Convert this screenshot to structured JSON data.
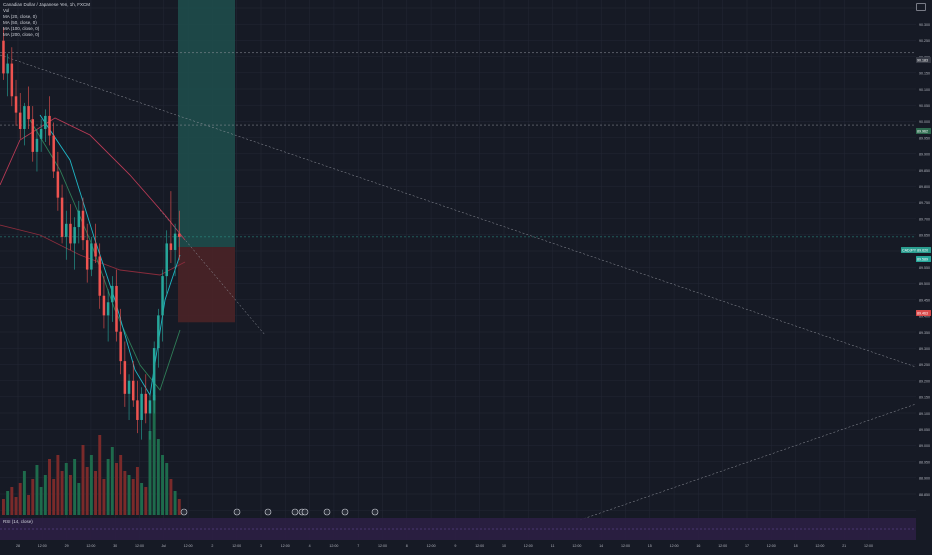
{
  "legend": {
    "symbol": "Canadian Dollar / Japanese Yen, 1h, FXCM",
    "vol": "Vol",
    "ma1": "MA (20, close, 0)",
    "ma2": "MA (50, close, 0)",
    "ma3": "MA (100, close, 0)",
    "ma4": "MA (200, close, 0)"
  },
  "rsi": {
    "label": "RSI (14, close)"
  },
  "price_axis": {
    "ticks": [
      "90.300",
      "90.250",
      "90.200",
      "90.150",
      "90.100",
      "90.050",
      "90.000",
      "89.950",
      "89.900",
      "89.850",
      "89.800",
      "89.750",
      "89.700",
      "89.650",
      "89.600",
      "89.550",
      "89.500",
      "89.450",
      "89.400",
      "89.350",
      "89.300",
      "89.250",
      "89.200",
      "89.150",
      "89.100",
      "89.050",
      "89.000",
      "88.950",
      "88.900",
      "88.850"
    ],
    "tags": [
      {
        "text": "90.183",
        "color": "#363a45"
      },
      {
        "text": "89.962",
        "color": "#2e6b4f"
      },
      {
        "text": "CADJPY 89.620",
        "color": "#2a9d8f"
      },
      {
        "text": "89.589",
        "color": "#26a69a"
      },
      {
        "text": "89.463",
        "color": "#d84a4a"
      }
    ]
  },
  "time_axis": {
    "ticks": [
      "28",
      "12:00",
      "29",
      "12:00",
      "30",
      "12:00",
      "Jul",
      "12:00",
      "2",
      "12:00",
      "3",
      "12:00",
      "4",
      "12:00",
      "7",
      "12:00",
      "8",
      "12:00",
      "9",
      "12:00",
      "10",
      "12:00",
      "11",
      "12:00",
      "14",
      "12:00",
      "15",
      "12:00",
      "16",
      "12:00",
      "17",
      "12:00",
      "18",
      "12:00",
      "21",
      "12:00"
    ]
  },
  "colors": {
    "background": "#161a25",
    "grid": "#242836",
    "up": "#26a69a",
    "down": "#ef5350",
    "ma20": "#1fb5c4",
    "ma50": "#2f7d57",
    "ma100": "#b83a55",
    "ma200": "#8a2c3c",
    "target": "#1e4d4b",
    "stop": "#4a2327",
    "rsi_band": "#2b1f44"
  },
  "chart_data": {
    "type": "candlestick",
    "candles": [
      [
        90.22,
        90.26,
        90.1,
        90.12
      ],
      [
        90.12,
        90.18,
        90.05,
        90.15
      ],
      [
        90.15,
        90.2,
        90.02,
        90.05
      ],
      [
        90.05,
        90.1,
        89.96,
        90.0
      ],
      [
        90.0,
        90.06,
        89.92,
        89.95
      ],
      [
        89.95,
        90.03,
        89.9,
        90.02
      ],
      [
        90.02,
        90.08,
        89.95,
        89.98
      ],
      [
        89.98,
        90.02,
        89.85,
        89.88
      ],
      [
        89.88,
        89.95,
        89.82,
        89.92
      ],
      [
        89.92,
        89.98,
        89.88,
        89.95
      ],
      [
        89.95,
        90.01,
        89.91,
        89.99
      ],
      [
        89.99,
        90.05,
        89.9,
        89.93
      ],
      [
        89.93,
        89.97,
        89.8,
        89.82
      ],
      [
        89.82,
        89.88,
        89.7,
        89.74
      ],
      [
        89.74,
        89.78,
        89.6,
        89.62
      ],
      [
        89.62,
        89.7,
        89.55,
        89.66
      ],
      [
        89.66,
        89.72,
        89.58,
        89.6
      ],
      [
        89.6,
        89.68,
        89.52,
        89.65
      ],
      [
        89.65,
        89.73,
        89.6,
        89.7
      ],
      [
        89.7,
        89.74,
        89.58,
        89.61
      ],
      [
        89.61,
        89.66,
        89.48,
        89.52
      ],
      [
        89.52,
        89.62,
        89.5,
        89.6
      ],
      [
        89.6,
        89.66,
        89.54,
        89.56
      ],
      [
        89.56,
        89.6,
        89.4,
        89.44
      ],
      [
        89.44,
        89.5,
        89.34,
        89.38
      ],
      [
        89.38,
        89.46,
        89.3,
        89.42
      ],
      [
        89.42,
        89.5,
        89.36,
        89.47
      ],
      [
        89.47,
        89.52,
        89.3,
        89.33
      ],
      [
        89.33,
        89.4,
        89.2,
        89.24
      ],
      [
        89.24,
        89.3,
        89.1,
        89.14
      ],
      [
        89.14,
        89.2,
        89.06,
        89.18
      ],
      [
        89.18,
        89.24,
        89.1,
        89.12
      ],
      [
        89.12,
        89.18,
        89.02,
        89.06
      ],
      [
        89.06,
        89.16,
        89.0,
        89.14
      ],
      [
        89.14,
        89.2,
        89.05,
        89.08
      ],
      [
        89.08,
        89.14,
        89.0,
        89.12
      ],
      [
        89.12,
        89.3,
        89.08,
        89.28
      ],
      [
        89.28,
        89.4,
        89.22,
        89.38
      ],
      [
        89.38,
        89.52,
        89.3,
        89.5
      ],
      [
        89.5,
        89.64,
        89.44,
        89.6
      ],
      [
        89.6,
        89.76,
        89.54,
        89.58
      ],
      [
        89.58,
        89.66,
        89.5,
        89.63
      ],
      [
        89.63,
        89.7,
        89.55,
        89.62
      ]
    ],
    "volumes": [
      8,
      12,
      14,
      9,
      16,
      22,
      10,
      18,
      25,
      14,
      20,
      28,
      18,
      30,
      22,
      26,
      20,
      28,
      16,
      35,
      24,
      30,
      22,
      40,
      18,
      28,
      34,
      26,
      30,
      22,
      20,
      18,
      24,
      16,
      14,
      42,
      60,
      38,
      30,
      26,
      18,
      12,
      8
    ],
    "ylim": [
      88.8,
      90.32
    ],
    "position": {
      "entry": 89.589,
      "target": 90.18,
      "stop": 89.42
    },
    "hlines": [
      90.183,
      89.962,
      89.62
    ]
  }
}
